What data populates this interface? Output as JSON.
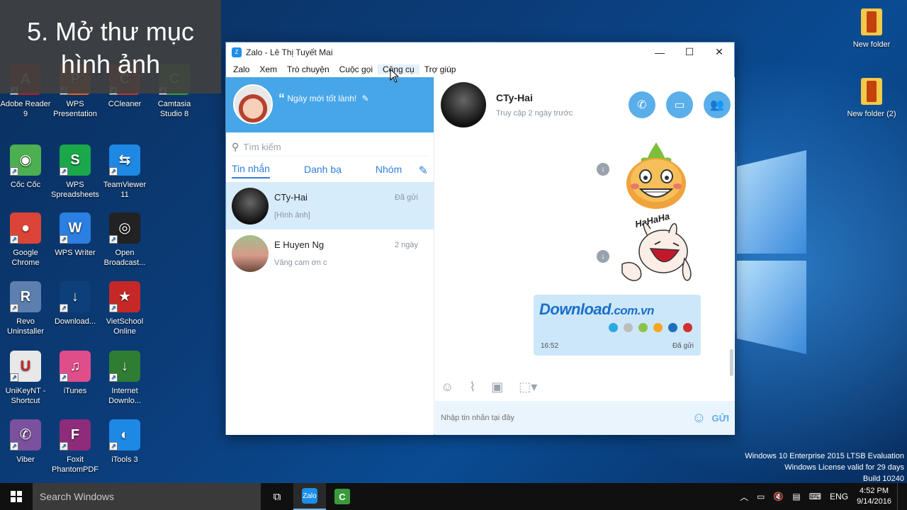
{
  "caption": {
    "line1": "5. Mở thư mục",
    "line2": "hình ảnh"
  },
  "desktop_icons": [
    {
      "label": "Adobe Reader 9",
      "icon": "adobe-reader-icon",
      "color": "#b32020",
      "glyph": "A"
    },
    {
      "label": "WPS Presentation",
      "icon": "wps-presentation-icon",
      "color": "#e0621f",
      "glyph": "P"
    },
    {
      "label": "CCleaner",
      "icon": "ccleaner-icon",
      "color": "#c0392b",
      "glyph": "C"
    },
    {
      "label": "Camtasia Studio 8",
      "icon": "camtasia-icon",
      "color": "#3a9a3a",
      "glyph": "C"
    },
    {
      "label": "Cốc Cốc",
      "icon": "coccoc-icon",
      "color": "#4caf50",
      "glyph": "◉"
    },
    {
      "label": "WPS Spreadsheets",
      "icon": "wps-spreadsheets-icon",
      "color": "#1aa84a",
      "glyph": "S"
    },
    {
      "label": "TeamViewer 11",
      "icon": "teamviewer-icon",
      "color": "#1e88e5",
      "glyph": "⇆"
    },
    {
      "label": "Google Chrome",
      "icon": "chrome-icon",
      "color": "#db4437",
      "glyph": "●"
    },
    {
      "label": "WPS Writer",
      "icon": "wps-writer-icon",
      "color": "#2a7fe0",
      "glyph": "W"
    },
    {
      "label": "Open Broadcast...",
      "icon": "obs-icon",
      "color": "#222222",
      "glyph": "◎"
    },
    {
      "label": "Revo Uninstaller",
      "icon": "revo-icon",
      "color": "#5d7fb0",
      "glyph": "R"
    },
    {
      "label": "Download...",
      "icon": "download-icon",
      "color": "#0d3f7a",
      "glyph": "↓"
    },
    {
      "label": "VietSchool Online",
      "icon": "vietschool-icon",
      "color": "#c62828",
      "glyph": "★"
    },
    {
      "label": "UniKeyNT - Shortcut",
      "icon": "unikey-icon",
      "color": "#e8e8e8",
      "glyph": "U"
    },
    {
      "label": "iTunes",
      "icon": "itunes-icon",
      "color": "#e04d8b",
      "glyph": "♫"
    },
    {
      "label": "Internet Downlo...",
      "icon": "idm-icon",
      "color": "#2e7d32",
      "glyph": "↓"
    },
    {
      "label": "Viber",
      "icon": "viber-icon",
      "color": "#7b519d",
      "glyph": "✆"
    },
    {
      "label": "Foxit PhantomPDF",
      "icon": "foxit-icon",
      "color": "#8e2c7a",
      "glyph": "F"
    },
    {
      "label": "iTools 3",
      "icon": "itools-icon",
      "color": "#1e88e5",
      "glyph": "◐"
    }
  ],
  "right_icons": [
    {
      "label": "New folder",
      "icon": "folder-icon"
    },
    {
      "label": "New folder (2)",
      "icon": "folder-icon"
    }
  ],
  "window": {
    "title": "Zalo - Lê Thị Tuyết Mai",
    "menu": [
      "Zalo",
      "Xem",
      "Trò chuyện",
      "Cuộc gọi",
      "Công cụ",
      "Trợ giúp"
    ],
    "status_message": "Ngày mới tốt lành!",
    "search_placeholder": "Tìm kiếm",
    "tabs": [
      "Tin nhắn",
      "Danh bạ",
      "Nhóm"
    ],
    "conversations": [
      {
        "name": "CTy-Hai",
        "preview": "[Hình ảnh]",
        "time": "Đã gửi"
      },
      {
        "name": "E Huyen Ng",
        "preview": "Vâng cam ơn c",
        "time": "2 ngày"
      }
    ],
    "chat": {
      "name": "CTy-Hai",
      "last_seen": "Truy cập 2 ngày trước",
      "sticker2_text": "HaHaHa",
      "card_brand": "Download",
      "card_domain": ".com.vn",
      "card_time": "16:52",
      "card_state": "Đã gửi",
      "input_placeholder": "Nhập tin nhắn tại đây",
      "send_label": "GỬI"
    }
  },
  "watermark": {
    "line1": "Windows 10 Enterprise 2015 LTSB Evaluation",
    "line2": "Windows License valid for 29 days",
    "line3": "Build 10240"
  },
  "taskbar": {
    "search": "Search Windows",
    "lang": "ENG",
    "time": "4:52 PM",
    "date": "9/14/2016"
  },
  "colors": {
    "zalo_blue": "#46a6e8",
    "accent": "#2f7fd8",
    "card_dots": [
      "#2aa9e0",
      "#bdbdbd",
      "#8bc34a",
      "#f4a623",
      "#1e6fb8",
      "#d32f2f"
    ]
  }
}
